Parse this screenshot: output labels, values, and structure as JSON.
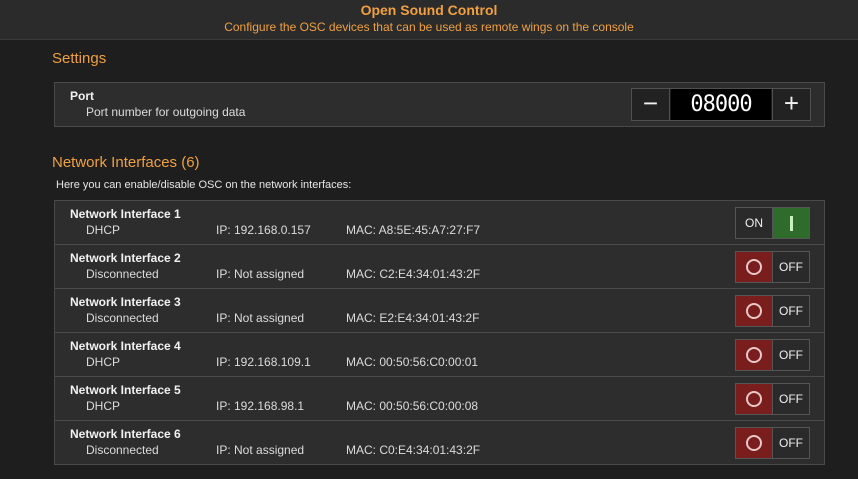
{
  "header": {
    "title": "Open Sound Control",
    "subtitle": "Configure the OSC devices that can be used as remote wings on the console"
  },
  "settings": {
    "title": "Settings",
    "port": {
      "label": "Port",
      "description": "Port number for outgoing data",
      "value": "08000",
      "decrement_label": "−",
      "increment_label": "+"
    }
  },
  "network": {
    "title": "Network Interfaces (6)",
    "description": "Here you can enable/disable OSC on the network interfaces:",
    "interfaces": [
      {
        "name": "Network Interface 1",
        "mode": "DHCP",
        "ip": "IP: 192.168.0.157",
        "mac": "MAC: A8:5E:45:A7:27:F7",
        "state": "ON"
      },
      {
        "name": "Network Interface 2",
        "mode": "Disconnected",
        "ip": "IP: Not assigned",
        "mac": "MAC: C2:E4:34:01:43:2F",
        "state": "OFF"
      },
      {
        "name": "Network Interface 3",
        "mode": "Disconnected",
        "ip": "IP: Not assigned",
        "mac": "MAC: E2:E4:34:01:43:2F",
        "state": "OFF"
      },
      {
        "name": "Network Interface 4",
        "mode": "DHCP",
        "ip": "IP: 192.168.109.1",
        "mac": "MAC: 00:50:56:C0:00:01",
        "state": "OFF"
      },
      {
        "name": "Network Interface 5",
        "mode": "DHCP",
        "ip": "IP: 192.168.98.1",
        "mac": "MAC: 00:50:56:C0:00:08",
        "state": "OFF"
      },
      {
        "name": "Network Interface 6",
        "mode": "Disconnected",
        "ip": "IP: Not assigned",
        "mac": "MAC: C0:E4:34:01:43:2F",
        "state": "OFF"
      }
    ]
  },
  "colors": {
    "accent": "#f0a040",
    "toggle_on": "#2f6b2a",
    "toggle_off": "#7a1d1d"
  }
}
